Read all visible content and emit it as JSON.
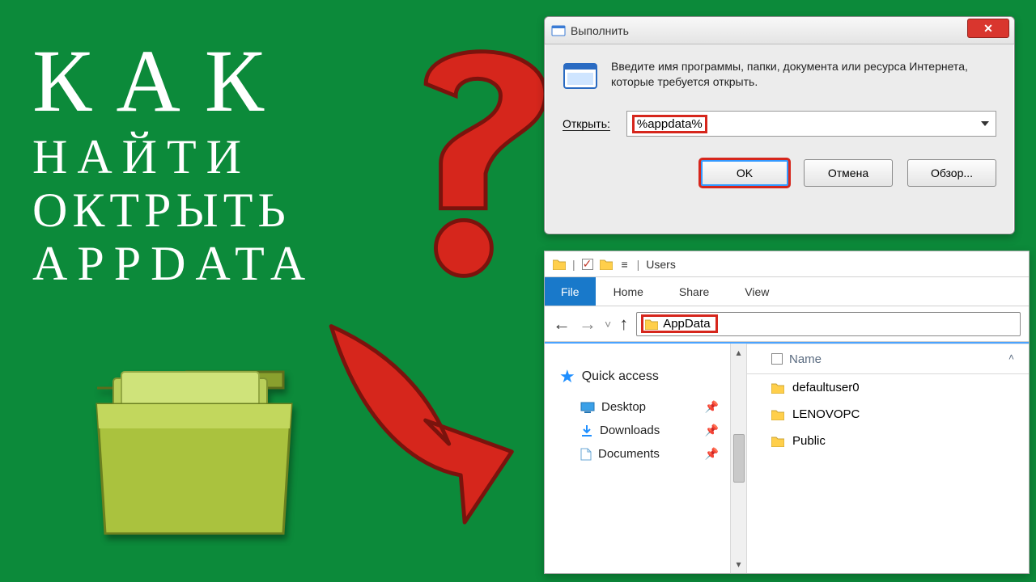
{
  "headline": {
    "w1": "КАК",
    "w2": "НАЙТИ",
    "w3": "ОКТРЫТЬ",
    "w4": "APPDATA"
  },
  "run": {
    "title": "Выполнить",
    "instruction": "Введите имя программы, папки, документа или ресурса Интернета, которые требуется открыть.",
    "open_label": "Открыть:",
    "value": "%appdata%",
    "ok": "OK",
    "cancel": "Отмена",
    "browse": "Обзор..."
  },
  "explorer": {
    "title": "Users",
    "tabs": {
      "file": "File",
      "home": "Home",
      "share": "Share",
      "view": "View"
    },
    "address": "AppData",
    "nav": {
      "quick_access": "Quick access",
      "items": [
        {
          "label": "Desktop"
        },
        {
          "label": "Downloads"
        },
        {
          "label": "Documents"
        }
      ]
    },
    "columns": {
      "name": "Name"
    },
    "rows": [
      {
        "name": "defaultuser0"
      },
      {
        "name": "LENOVOPC"
      },
      {
        "name": "Public"
      }
    ]
  }
}
